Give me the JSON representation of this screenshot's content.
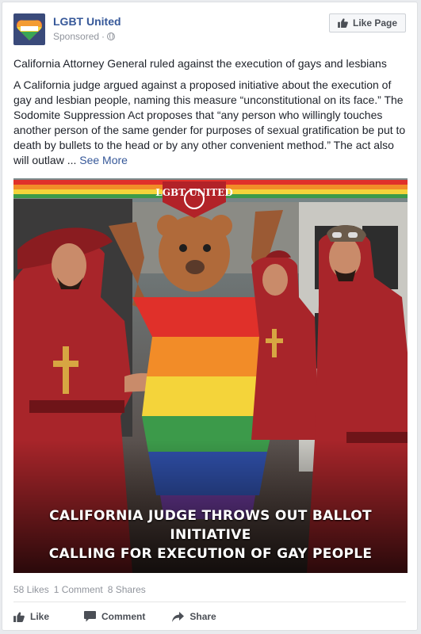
{
  "post": {
    "page_name": "LGBT United",
    "sponsored": "Sponsored",
    "sep": "·",
    "like_page_label": "Like Page",
    "headline": "California Attorney General ruled against the execution of gays and lesbians",
    "body": "A California judge argued against a proposed initiative about the execution of gay and lesbian people, naming this measure “unconstitutional on its face.” The Sodomite Suppression Act proposes that “any person who willingly touches another person of the same gender for purposes of sexual gratification be put to death by bullets to the head or by any other convenient method.” The act also will outlaw ...",
    "see_more": "See More",
    "logo_text": "LGBT UNITED",
    "image_caption_line1": "CALIFORNIA JUDGE THROWS OUT BALLOT INITIATIVE",
    "image_caption_line2": "CALLING FOR EXECUTION OF GAY PEOPLE"
  },
  "stats": {
    "likes": "58 Likes",
    "comments": "1 Comment",
    "shares": "8 Shares"
  },
  "actions": {
    "like": "Like",
    "comment": "Comment",
    "share": "Share"
  },
  "colors": {
    "link": "#365899",
    "text": "#1d2129",
    "muted": "#90949c"
  }
}
